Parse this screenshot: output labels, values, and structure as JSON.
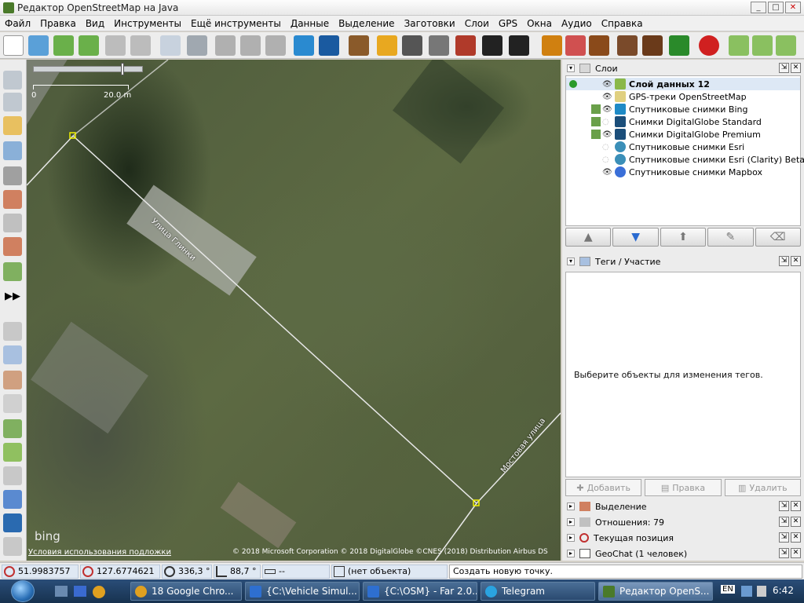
{
  "window": {
    "title": "Редактор OpenStreetMap на Java",
    "min": "_",
    "max": "□",
    "close": "✕"
  },
  "menu": [
    "Файл",
    "Правка",
    "Вид",
    "Инструменты",
    "Ещё инструменты",
    "Данные",
    "Выделение",
    "Заготовки",
    "Слои",
    "GPS",
    "Окна",
    "Аудио",
    "Справка"
  ],
  "map": {
    "scale_start": "0",
    "scale_end": "20.0 m",
    "street1": "Улица Глинки",
    "street2": "Мостовая улица",
    "terms": "Условия использования подложки",
    "attribution": "© 2018 Microsoft Corporation © 2018 DigitalGlobe ©CNES (2018) Distribution Airbus DS",
    "bing": "bing"
  },
  "layers_panel": {
    "title": "Слои",
    "layers": [
      {
        "name": "Слой данных 12",
        "active": true,
        "visible": true,
        "color": "#8ab84a"
      },
      {
        "name": "GPS-треки OpenStreetMap",
        "visible": true,
        "color": "#e0d080"
      },
      {
        "name": "Спутниковые снимки Bing",
        "visible": true,
        "color": "#1e8ac6"
      },
      {
        "name": "Снимки DigitalGlobe Standard",
        "visible": false,
        "color": "#1b4e7a"
      },
      {
        "name": "Снимки DigitalGlobe Premium",
        "visible": true,
        "color": "#1b4e7a"
      },
      {
        "name": "Спутниковые снимки Esri",
        "visible": false,
        "color": "#3b8fb8"
      },
      {
        "name": "Спутниковые снимки Esri (Clarity) Beta",
        "visible": false,
        "color": "#3b8fb8"
      },
      {
        "name": "Спутниковые снимки Mapbox",
        "visible": true,
        "color": "#3a6fd8"
      }
    ],
    "buttons": [
      "▲",
      "▼",
      "⬆",
      "✎",
      "⌫"
    ]
  },
  "tags_panel": {
    "title": "Теги / Участие",
    "message": "Выберите объекты для изменения тегов.",
    "add": "Добавить",
    "edit": "Правка",
    "delete": "Удалить"
  },
  "collapsed_panels": [
    "Выделение",
    "Отношения: 79",
    "Текущая позиция",
    "GeoChat (1 человек)"
  ],
  "status": {
    "lat": "51.9983757",
    "lon": "127.6774621",
    "heading": "336,3 °",
    "angle": "88,7 °",
    "dist": "--",
    "object": "(нет объекта)",
    "hint": "Создать новую точку."
  },
  "taskbar": {
    "tasks": [
      {
        "label": "18  Google Chro...",
        "color": "#e0a020"
      },
      {
        "label": "{C:\\Vehicle Simul...",
        "color": "#2e6fd0"
      },
      {
        "label": "{C:\\OSM} - Far 2.0...",
        "color": "#2e6fd0"
      },
      {
        "label": "Telegram",
        "color": "#2aa3e0"
      },
      {
        "label": "Редактор OpenS...",
        "color": "#4a7a2a"
      }
    ],
    "lang": "EN",
    "clock": "6:42"
  }
}
